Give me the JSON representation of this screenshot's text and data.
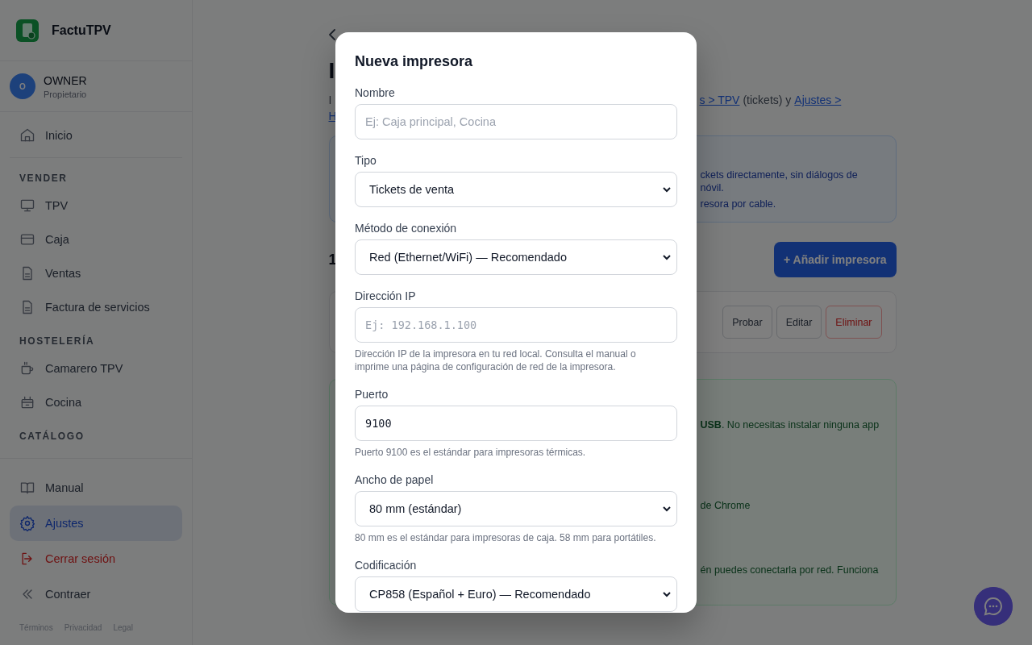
{
  "sidebar": {
    "brand": "FactuTPV",
    "user": {
      "initial": "O",
      "name": "OWNER",
      "role": "Propietario"
    },
    "top_items": [
      {
        "label": "Inicio",
        "selected": false,
        "kind": "normal"
      }
    ],
    "sections": [
      {
        "title": "VENDER",
        "items": [
          {
            "label": "TPV",
            "selected": false,
            "kind": "normal"
          },
          {
            "label": "Caja",
            "selected": false,
            "kind": "normal"
          },
          {
            "label": "Ventas",
            "selected": false,
            "kind": "normal"
          },
          {
            "label": "Factura de servicios",
            "selected": false,
            "kind": "normal"
          }
        ]
      },
      {
        "title": "HOSTELERÍA",
        "items": [
          {
            "label": "Camarero TPV",
            "selected": false,
            "kind": "normal"
          },
          {
            "label": "Cocina",
            "selected": false,
            "kind": "normal"
          }
        ]
      },
      {
        "title": "CATÁLOGO"
      }
    ],
    "bottom_items": [
      {
        "label": "Manual",
        "selected": false,
        "kind": "normal"
      },
      {
        "label": "Ajustes",
        "selected": true,
        "kind": "normal"
      },
      {
        "label": "Cerrar sesión",
        "selected": false,
        "kind": "danger"
      },
      {
        "label": "Contraer",
        "selected": false,
        "kind": "normal"
      }
    ],
    "footer_links": [
      "Términos",
      "Privacidad",
      "Legal"
    ]
  },
  "main": {
    "title": "I",
    "intro": [
      {
        "text": "I",
        "kind": "text"
      },
      {
        "text": "s > TPV",
        "kind": "link"
      },
      {
        "text": "(tickets) y",
        "kind": "text"
      },
      {
        "text": "Ajustes >",
        "kind": "link"
      },
      {
        "text": "H",
        "kind": "link"
      }
    ],
    "info_lines": [
      "ckets directamente, sin diálogos de",
      "nóvil.",
      "resora por cable."
    ],
    "count": "1",
    "add_button": "+ Añadir impresora",
    "printer_buttons": [
      {
        "label": "Probar",
        "kind": "normal"
      },
      {
        "label": "Editar",
        "kind": "normal"
      },
      {
        "label": "Eliminar",
        "kind": "danger"
      }
    ],
    "usb_lines": [
      "**USB**. No necesitas instalar ninguna app",
      "de Chrome",
      "én puedes conectarla por red. Funciona"
    ]
  },
  "modal": {
    "title": "Nueva impresora",
    "fields": [
      {
        "label": "Nombre",
        "kind": "text",
        "placeholder": "Ej: Caja principal, Cocina",
        "mono": false
      },
      {
        "label": "Tipo",
        "kind": "select",
        "value": "Tickets de venta",
        "mono": false
      },
      {
        "label": "Método de conexión",
        "kind": "select",
        "value": "Red (Ethernet/WiFi) — Recomendado",
        "mono": false
      },
      {
        "label": "Dirección IP",
        "kind": "text",
        "placeholder": "Ej: 192.168.1.100",
        "mono": true,
        "help": "Dirección IP de la impresora en tu red local. Consulta el manual o imprime una página de configuración de red de la impresora."
      },
      {
        "label": "Puerto",
        "kind": "text",
        "value": "9100",
        "mono": true,
        "help": "Puerto 9100 es el estándar para impresoras térmicas."
      },
      {
        "label": "Ancho de papel",
        "kind": "select",
        "value": "80 mm (estándar)",
        "mono": false,
        "help": "80 mm es el estándar para impresoras de caja. 58 mm para portátiles."
      },
      {
        "label": "Codificación",
        "kind": "select",
        "value": "CP858 (Español + Euro) — Recomendado",
        "mono": false
      }
    ]
  }
}
